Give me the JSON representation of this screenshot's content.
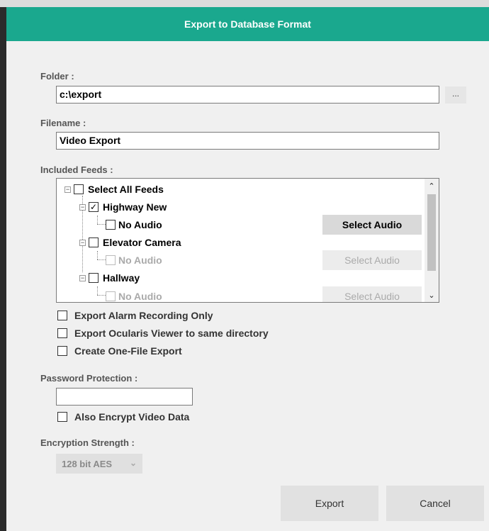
{
  "window": {
    "title": "Export to Database Format"
  },
  "folder": {
    "label": "Folder :",
    "value": "c:\\export",
    "browse_label": "..."
  },
  "filename": {
    "label": "Filename :",
    "value": "Video Export"
  },
  "feeds": {
    "label": "Included Feeds :",
    "select_all": {
      "label": "Select All Feeds",
      "checked": false
    },
    "items": [
      {
        "label": "Highway New",
        "checked": true,
        "audio_label": "No Audio",
        "audio_enabled": true,
        "button": "Select Audio"
      },
      {
        "label": "Elevator Camera",
        "checked": false,
        "audio_label": "No Audio",
        "audio_enabled": false,
        "button": "Select Audio"
      },
      {
        "label": "Hallway",
        "checked": false,
        "audio_label": "No Audio",
        "audio_enabled": false,
        "button": "Select Audio"
      }
    ]
  },
  "options": {
    "alarm_only": "Export Alarm Recording Only",
    "viewer": "Export Ocularis Viewer to same directory",
    "one_file": "Create One-File Export"
  },
  "password": {
    "label": "Password Protection :",
    "value": "",
    "encrypt_label": "Also Encrypt Video Data"
  },
  "encryption": {
    "label": "Encryption Strength :",
    "selected": "128 bit AES"
  },
  "buttons": {
    "export": "Export",
    "cancel": "Cancel"
  },
  "colors": {
    "title_bar": "#1aa88e"
  }
}
